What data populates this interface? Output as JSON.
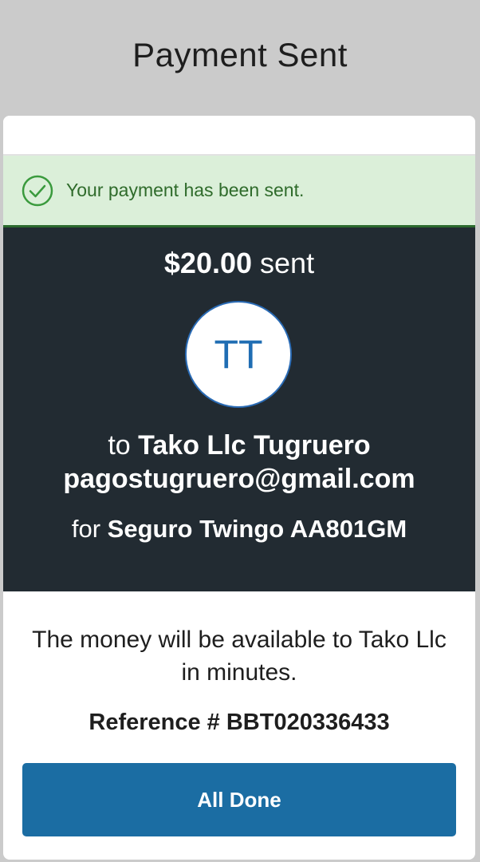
{
  "header": {
    "title": "Payment Sent"
  },
  "alert": {
    "icon": "check-circle-icon",
    "message": "Your payment has been sent.",
    "color": "#2f6b2b",
    "background": "#dbefd9"
  },
  "summary": {
    "amount": "$20.00",
    "amount_suffix": "sent",
    "avatar_initials": "TT",
    "to_prefix": "to",
    "recipient_name": "Tako Llc Tugruero",
    "recipient_email": "pagostugruero@gmail.com",
    "for_prefix": "for",
    "memo": "Seguro Twingo AA801GM",
    "background": "#222b32"
  },
  "details": {
    "availability": "The money will be available to Tako Llc in minutes.",
    "reference": "Reference # BBT020336433"
  },
  "actions": {
    "done_label": "All Done",
    "accent": "#1b6da3"
  }
}
